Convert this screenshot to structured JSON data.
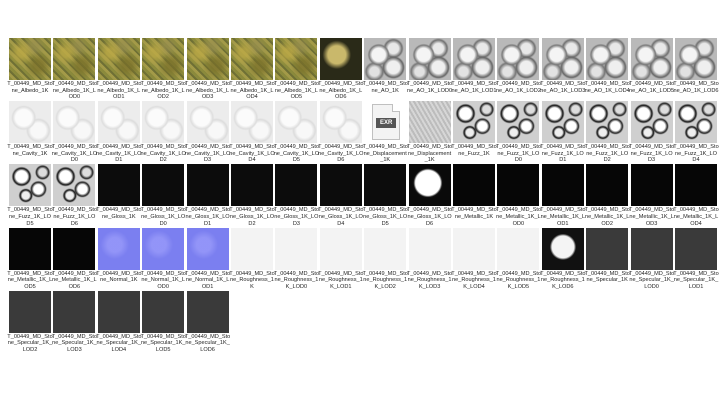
{
  "files": [
    {
      "name": "T_00449_MD_Stone_Albedo_1K",
      "style": "albedo"
    },
    {
      "name": "T_00449_MD_Stone_Albedo_1K_LOD0",
      "style": "albedo"
    },
    {
      "name": "T_00449_MD_Stone_Albedo_1K_LOD1",
      "style": "albedo"
    },
    {
      "name": "T_00449_MD_Stone_Albedo_1K_LOD2",
      "style": "albedo"
    },
    {
      "name": "T_00449_MD_Stone_Albedo_1K_LOD3",
      "style": "albedo"
    },
    {
      "name": "T_00449_MD_Stone_Albedo_1K_LOD4",
      "style": "albedo"
    },
    {
      "name": "T_00449_MD_Stone_Albedo_1K_LOD5",
      "style": "albedo"
    },
    {
      "name": "T_00449_MD_Stone_Albedo_1K_LOD6",
      "style": "alb-lod6"
    },
    {
      "name": "T_00449_MD_Stone_AO_1K",
      "style": "ao"
    },
    {
      "name": "T_00449_MD_Stone_AO_1K_LOD0",
      "style": "ao"
    },
    {
      "name": "T_00449_MD_Stone_AO_1K_LOD1",
      "style": "ao"
    },
    {
      "name": "T_00449_MD_Stone_AO_1K_LOD2",
      "style": "ao"
    },
    {
      "name": "T_00449_MD_Stone_AO_1K_LOD3",
      "style": "ao"
    },
    {
      "name": "T_00449_MD_Stone_AO_1K_LOD4",
      "style": "ao"
    },
    {
      "name": "T_00449_MD_Stone_AO_1K_LOD5",
      "style": "ao"
    },
    {
      "name": "T_00449_MD_Stone_AO_1K_LOD6",
      "style": "ao"
    },
    {
      "name": "T_00449_MD_Stone_Cavity_1K",
      "style": "cavity"
    },
    {
      "name": "T_00449_MD_Stone_Cavity_1K_LOD0",
      "style": "cavity"
    },
    {
      "name": "T_00449_MD_Stone_Cavity_1K_LOD1",
      "style": "cavity"
    },
    {
      "name": "T_00449_MD_Stone_Cavity_1K_LOD2",
      "style": "cavity"
    },
    {
      "name": "T_00449_MD_Stone_Cavity_1K_LOD3",
      "style": "cavity"
    },
    {
      "name": "T_00449_MD_Stone_Cavity_1K_LOD4",
      "style": "cavity"
    },
    {
      "name": "T_00449_MD_Stone_Cavity_1K_LOD5",
      "style": "cavity"
    },
    {
      "name": "T_00449_MD_Stone_Cavity_1K_LOD6",
      "style": "cavity"
    },
    {
      "name": "T_00449_MD_Stone_Displacement_1K",
      "style": "exr",
      "badge": "EXR"
    },
    {
      "name": "T_00449_MD_Stone_Displacement_1K",
      "style": "disp2"
    },
    {
      "name": "T_00449_MD_Stone_Fuzz_1K",
      "style": "fuzz"
    },
    {
      "name": "T_00449_MD_Stone_Fuzz_1K_LOD0",
      "style": "fuzz"
    },
    {
      "name": "T_00449_MD_Stone_Fuzz_1K_LOD1",
      "style": "fuzz"
    },
    {
      "name": "T_00449_MD_Stone_Fuzz_1K_LOD2",
      "style": "fuzz"
    },
    {
      "name": "T_00449_MD_Stone_Fuzz_1K_LOD3",
      "style": "fuzz"
    },
    {
      "name": "T_00449_MD_Stone_Fuzz_1K_LOD4",
      "style": "fuzz"
    },
    {
      "name": "T_00449_MD_Stone_Fuzz_1K_LOD5",
      "style": "fuzz"
    },
    {
      "name": "T_00449_MD_Stone_Fuzz_1K_LOD6",
      "style": "fuzz"
    },
    {
      "name": "T_00449_MD_Stone_Gloss_1K",
      "style": "gloss"
    },
    {
      "name": "T_00449_MD_Stone_Gloss_1K_LOD0",
      "style": "gloss"
    },
    {
      "name": "T_00449_MD_Stone_Gloss_1K_LOD1",
      "style": "gloss"
    },
    {
      "name": "T_00449_MD_Stone_Gloss_1K_LOD2",
      "style": "gloss"
    },
    {
      "name": "T_00449_MD_Stone_Gloss_1K_LOD3",
      "style": "gloss"
    },
    {
      "name": "T_00449_MD_Stone_Gloss_1K_LOD4",
      "style": "gloss"
    },
    {
      "name": "T_00449_MD_Stone_Gloss_1K_LOD5",
      "style": "gloss"
    },
    {
      "name": "T_00449_MD_Stone_Gloss_1K_LOD6",
      "style": "white-rock"
    },
    {
      "name": "T_00449_MD_Stone_Metallic_1K",
      "style": "metal"
    },
    {
      "name": "T_00449_MD_Stone_Metallic_1K_LOD0",
      "style": "metal"
    },
    {
      "name": "T_00449_MD_Stone_Metallic_1K_LOD1",
      "style": "metal"
    },
    {
      "name": "T_00449_MD_Stone_Metallic_1K_LOD2",
      "style": "metal"
    },
    {
      "name": "T_00449_MD_Stone_Metallic_1K_LOD3",
      "style": "metal"
    },
    {
      "name": "T_00449_MD_Stone_Metallic_1K_LOD4",
      "style": "metal"
    },
    {
      "name": "T_00449_MD_Stone_Metallic_1K_LOD5",
      "style": "metal"
    },
    {
      "name": "T_00449_MD_Stone_Metallic_1K_LOD6",
      "style": "metal"
    },
    {
      "name": "T_00449_MD_Stone_Normal_1K",
      "style": "normal"
    },
    {
      "name": "T_00449_MD_Stone_Normal_1K_LOD0",
      "style": "normal"
    },
    {
      "name": "T_00449_MD_Stone_Normal_1K_LOD1",
      "style": "normal"
    },
    {
      "name": "T_00449_MD_Stone_Roughness_1K",
      "style": "rough"
    },
    {
      "name": "T_00449_MD_Stone_Roughness_1K_LOD0",
      "style": "rough"
    },
    {
      "name": "T_00449_MD_Stone_Roughness_1K_LOD1",
      "style": "rough"
    },
    {
      "name": "T_00449_MD_Stone_Roughness_1K_LOD2",
      "style": "rough"
    },
    {
      "name": "T_00449_MD_Stone_Roughness_1K_LOD3",
      "style": "rough"
    },
    {
      "name": "T_00449_MD_Stone_Roughness_1K_LOD4",
      "style": "rough"
    },
    {
      "name": "T_00449_MD_Stone_Roughness_1K_LOD5",
      "style": "rough"
    },
    {
      "name": "T_00449_MD_Stone_Roughness_1K_LOD6",
      "style": "rough6"
    },
    {
      "name": "T_00449_MD_Stone_Specular_1K",
      "style": "spec"
    },
    {
      "name": "T_00449_MD_Stone_Specular_1K_LOD0",
      "style": "spec"
    },
    {
      "name": "T_00449_MD_Stone_Specular_1K_LOD1",
      "style": "spec"
    },
    {
      "name": "T_00449_MD_Stone_Specular_1K_LOD2",
      "style": "spec"
    },
    {
      "name": "T_00449_MD_Stone_Specular_1K_LOD3",
      "style": "spec"
    },
    {
      "name": "T_00449_MD_Stone_Specular_1K_LOD4",
      "style": "spec"
    },
    {
      "name": "T_00449_MD_Stone_Specular_1K_LOD5",
      "style": "spec"
    },
    {
      "name": "T_00449_MD_Stone_Specular_1K_LOD6",
      "style": "spec"
    }
  ]
}
